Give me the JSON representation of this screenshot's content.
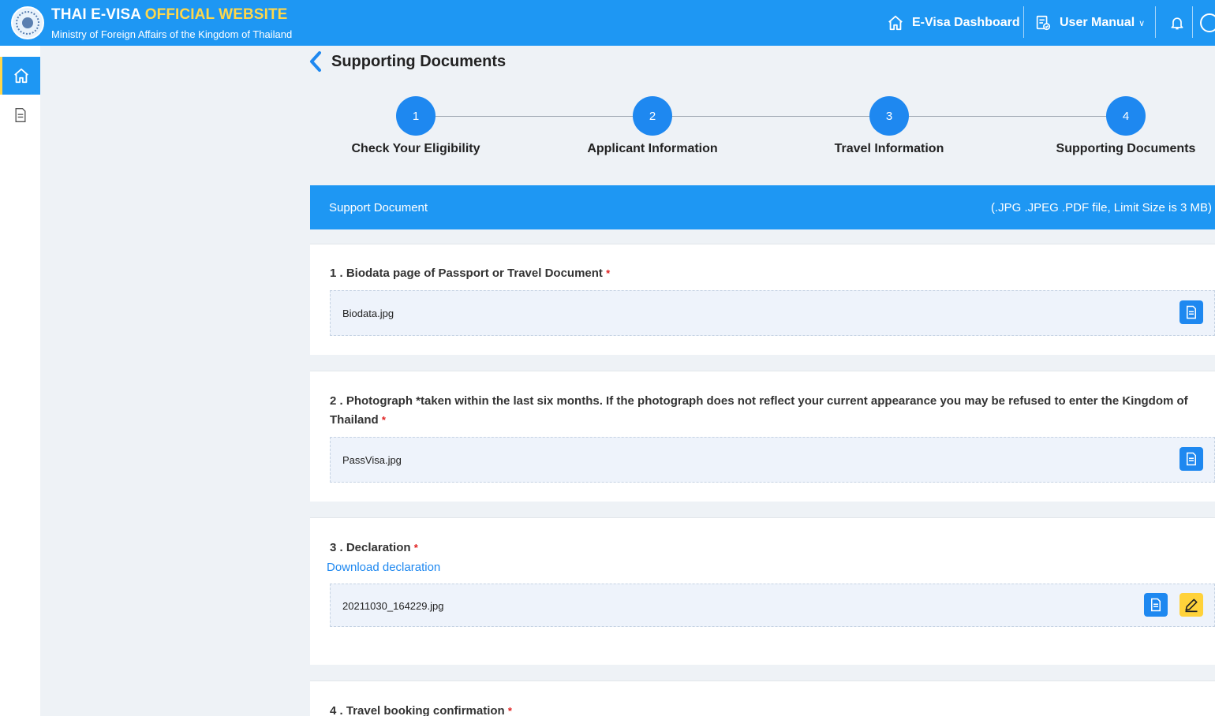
{
  "header": {
    "title_main": "THAI E-VISA",
    "title_accent": "OFFICIAL WEBSITE",
    "subtitle": "Ministry of Foreign Affairs of the Kingdom of Thailand",
    "nav": {
      "dashboard_label": "E-Visa Dashboard",
      "manual_label": "User Manual",
      "manual_chevron": "∨"
    }
  },
  "page": {
    "title": "Supporting Documents"
  },
  "stepper": {
    "steps": [
      {
        "number": "1",
        "label": "Check Your Eligibility"
      },
      {
        "number": "2",
        "label": "Applicant Information"
      },
      {
        "number": "3",
        "label": "Travel Information"
      },
      {
        "number": "4",
        "label": "Supporting Documents"
      }
    ]
  },
  "support": {
    "header_label": "Support Document",
    "header_note": "(.JPG .JPEG .PDF file, Limit Size is 3 MB)",
    "required_mark": "*",
    "items": [
      {
        "title": "1 . Biodata page of Passport or Travel Document",
        "file": "Biodata.jpg"
      },
      {
        "title": "2 . Photograph *taken within the last six months. If the photograph does not reflect your current appearance you may be refused to enter the Kingdom of Thailand",
        "file": "PassVisa.jpg"
      },
      {
        "title": "3 . Declaration",
        "link": "Download declaration",
        "file": "20211030_164229.jpg"
      },
      {
        "title": "4 . Travel booking confirmation"
      }
    ]
  },
  "colors": {
    "primary": "#1e97f3",
    "accent": "#ffd74a",
    "required": "#e02020"
  },
  "icons": [
    "home-icon",
    "document-icon",
    "user-manual-icon",
    "bell-icon",
    "back-chevron-icon",
    "view-file-icon",
    "edit-icon"
  ]
}
